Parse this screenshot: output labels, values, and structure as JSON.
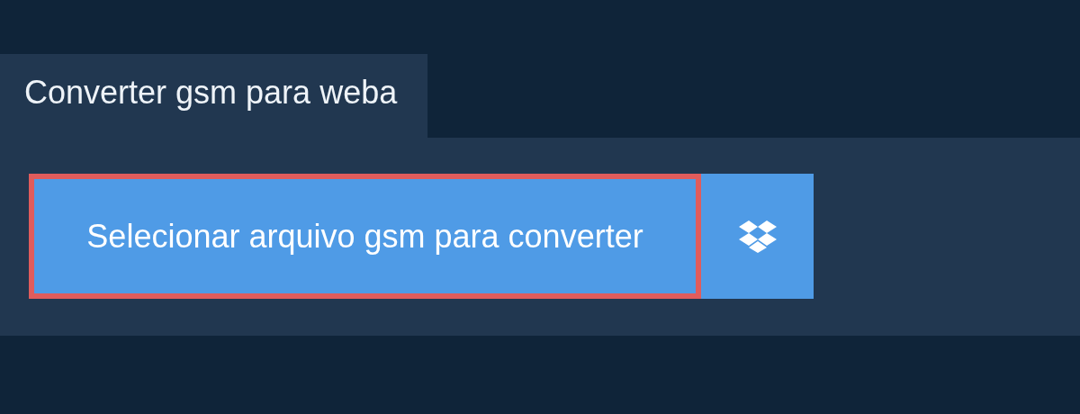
{
  "title": "Converter gsm para weba",
  "select_button": {
    "label": "Selecionar arquivo gsm para converter",
    "focused": true
  }
}
